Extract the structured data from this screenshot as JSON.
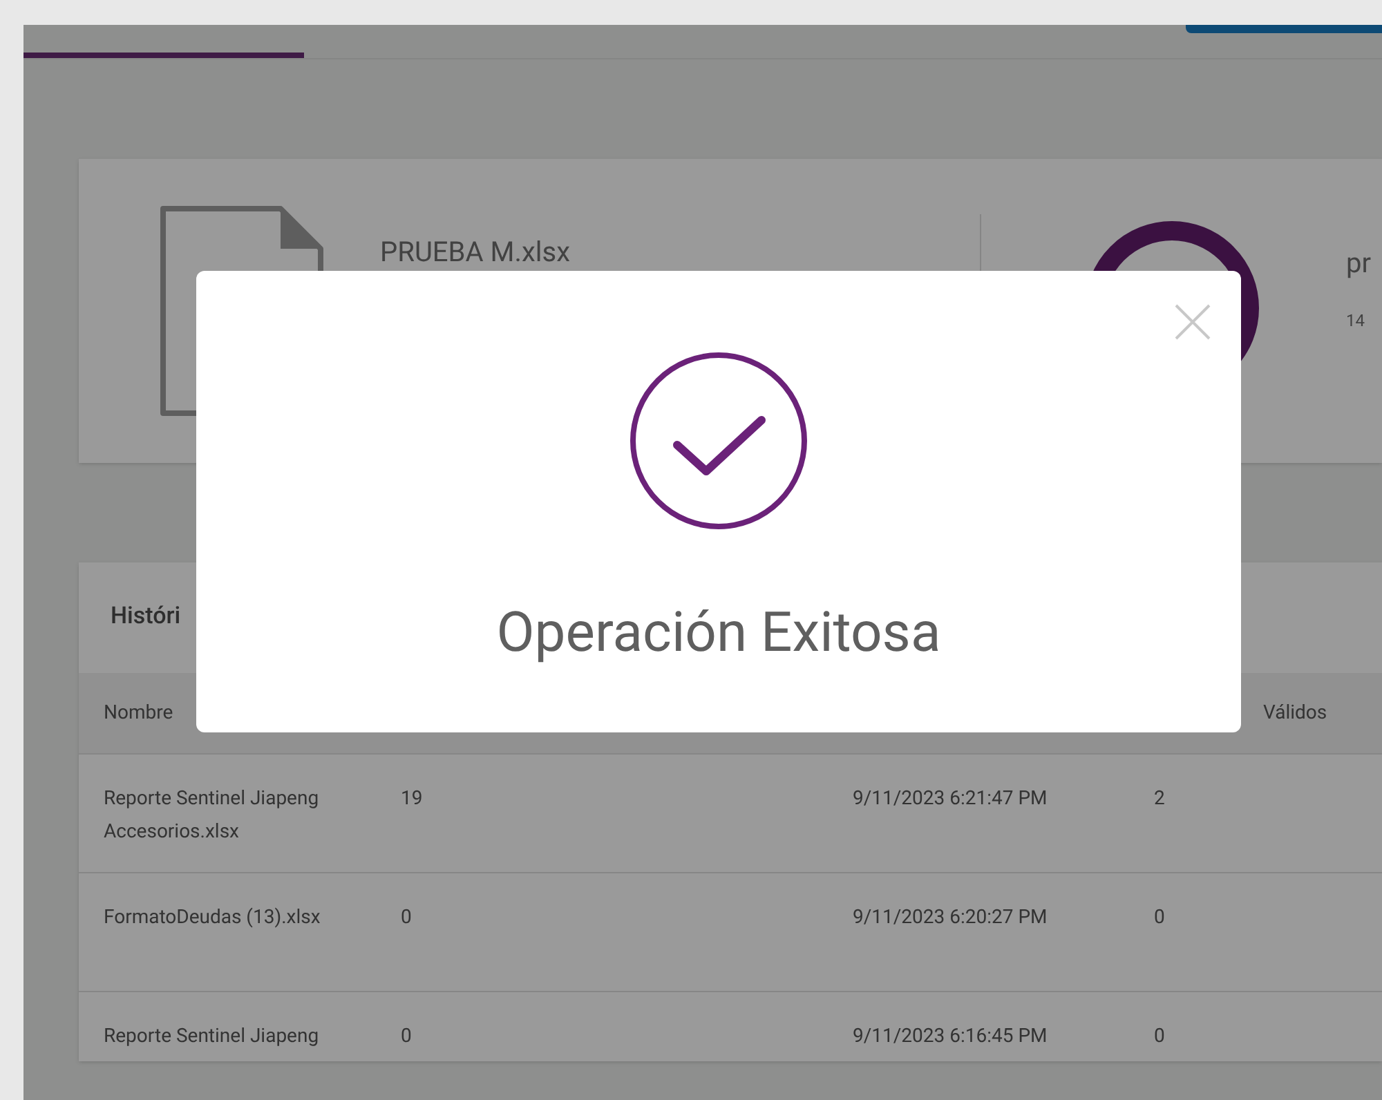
{
  "file_card": {
    "file_name": "PRUEBA M.xlsx",
    "summary_title": "pr",
    "summary_detail": "14"
  },
  "history": {
    "title": "Históri",
    "columns": [
      {
        "label": "Nombre"
      },
      {
        "label": "Válidos"
      }
    ],
    "rows": [
      {
        "cells": [
          "Reporte Sentinel Jiapeng Accesorios.xlsx",
          "19",
          "9/11/2023 6:21:47 PM",
          "2"
        ]
      },
      {
        "cells": [
          "FormatoDeudas (13).xlsx",
          "0",
          "9/11/2023 6:20:27 PM",
          "0"
        ]
      },
      {
        "cells": [
          "Reporte Sentinel Jiapeng",
          "0",
          "9/11/2023 6:16:45 PM",
          "0"
        ]
      }
    ]
  },
  "dialog": {
    "title": "Operación Exitosa"
  }
}
